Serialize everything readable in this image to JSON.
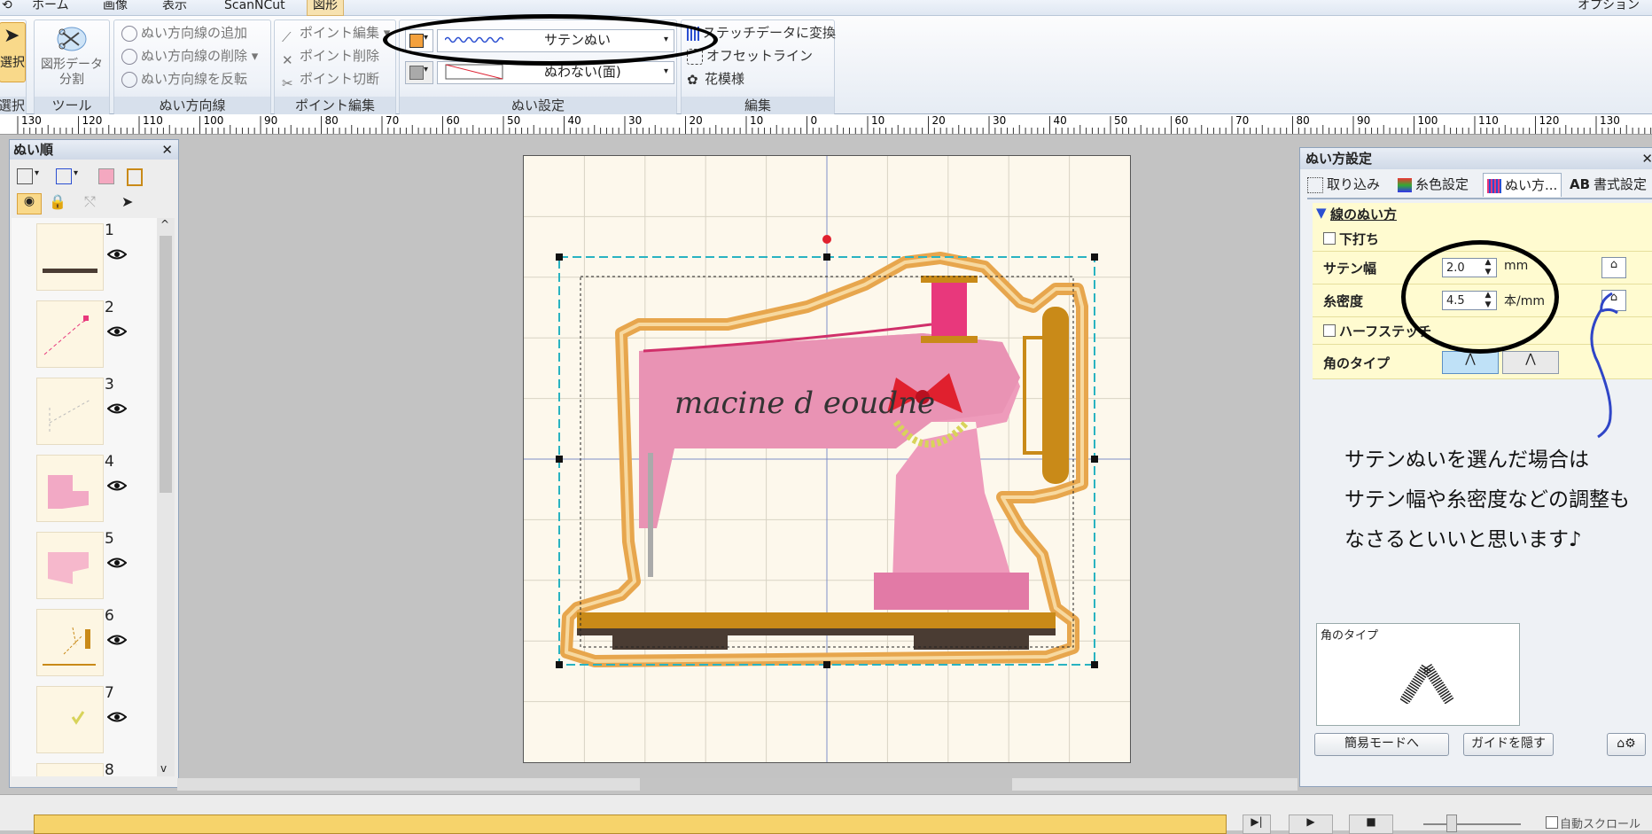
{
  "menu": {
    "tabs": [
      "ホーム",
      "画像",
      "表示",
      "ScanNCut",
      "図形"
    ],
    "right": "オプション"
  },
  "ribbon": {
    "select": {
      "label": "選択",
      "group": "選択"
    },
    "tool": {
      "label": "図形データ分割",
      "group": "ツール"
    },
    "direction": {
      "items": [
        "ぬい方向線の追加",
        "ぬい方向線の削除",
        "ぬい方向線を反転"
      ],
      "group": "ぬい方向線"
    },
    "point": {
      "items": [
        "ポイント編集",
        "ポイント削除",
        "ポイント切断"
      ],
      "group": "ポイント編集"
    },
    "sew": {
      "line_combo": "サテンぬい",
      "fill_combo": "ぬわない(面)",
      "group": "ぬい設定"
    },
    "edit": {
      "items": [
        "ステッチデータに変換",
        "オフセットライン",
        "花模様"
      ],
      "group": "編集"
    }
  },
  "ruler": {
    "labels": [
      "130",
      "120",
      "110",
      "100",
      "90",
      "80",
      "70",
      "60",
      "50",
      "40",
      "30",
      "20",
      "10",
      "0",
      "10",
      "20",
      "30",
      "40",
      "50",
      "60",
      "70",
      "80",
      "90",
      "100",
      "110",
      "120",
      "130"
    ]
  },
  "left_panel": {
    "title": "ぬい順",
    "items": [
      {
        "num": "1"
      },
      {
        "num": "2"
      },
      {
        "num": "3"
      },
      {
        "num": "4"
      },
      {
        "num": "5"
      },
      {
        "num": "6"
      },
      {
        "num": "7"
      },
      {
        "num": "8"
      }
    ]
  },
  "canvas": {
    "text": "macine d eoudne"
  },
  "right_panel": {
    "title": "ぬい方設定",
    "tabs": [
      "取り込み",
      "糸色設定",
      "ぬい方...",
      "書式設定"
    ],
    "tab_ab": "AB",
    "section": "線のぬい方",
    "underlay_label": "下打ち",
    "satin_width": {
      "label": "サテン幅",
      "value": "2.0",
      "unit": "mm"
    },
    "density": {
      "label": "糸密度",
      "value": "4.5",
      "unit": "本/mm"
    },
    "half_stitch_label": "ハーフステッチ",
    "corner_label": "角のタイプ",
    "preview_label": "角のタイプ",
    "easy_mode_button": "簡易モードへ",
    "hide_guide_button": "ガイドを隠す"
  },
  "annotation": {
    "lines": [
      "サテンぬいを選んだ場合は",
      "サテン幅や糸密度などの調整も",
      "なさるといいと思います♪"
    ]
  },
  "bottom": {
    "auto_scroll": "自動スクロール"
  },
  "colors": {
    "tab_active": "#f7e2b0",
    "guide_yellow": "#fffbd0",
    "highlight_circle": "#000000",
    "annotation_arrow": "#2f45c7",
    "progress_bar": "#f6d36b"
  }
}
